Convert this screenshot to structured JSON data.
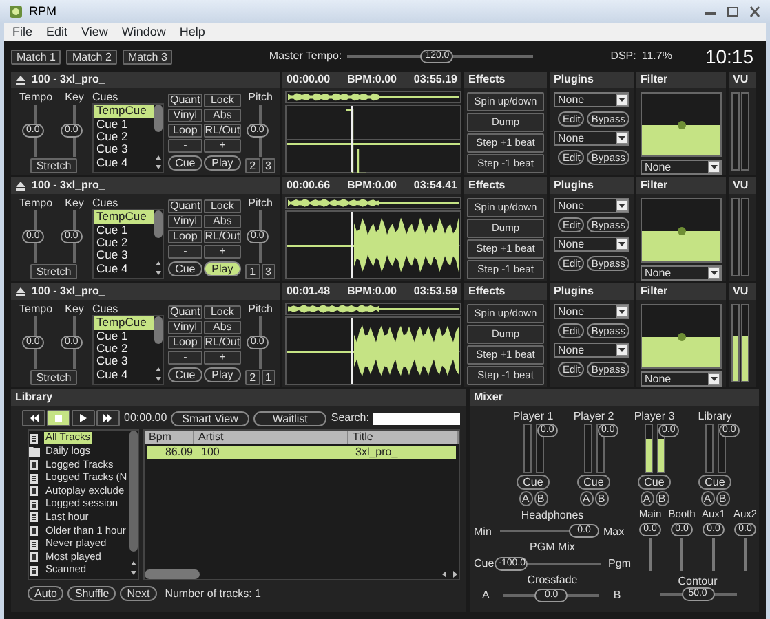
{
  "window": {
    "title": "RPM"
  },
  "menu": [
    "File",
    "Edit",
    "View",
    "Window",
    "Help"
  ],
  "toolbar": {
    "match_buttons": [
      "Match 1",
      "Match 2",
      "Match 3"
    ],
    "master_tempo": {
      "label": "Master Tempo:",
      "value": "120.0",
      "level": 0.48
    },
    "dsp": {
      "label": "DSP:",
      "value": "11.7%"
    },
    "clock": "10:15"
  },
  "decks": [
    {
      "title": "100 - 3xl_pro_",
      "tempo": {
        "label": "Tempo",
        "value": "0.0",
        "level": 0.5
      },
      "key": {
        "label": "Key",
        "value": "0.0",
        "level": 0.5
      },
      "stretch": "Stretch",
      "cues": {
        "label": "Cues",
        "items": [
          {
            "label": "TempCue",
            "selected": true
          },
          {
            "label": "Cue 1",
            "selected": false
          },
          {
            "label": "Cue 2",
            "selected": false
          },
          {
            "label": "Cue 3",
            "selected": false
          },
          {
            "label": "Cue 4",
            "selected": false
          }
        ]
      },
      "buttons": [
        "Quant",
        "Lock",
        "Vinyl",
        "Abs",
        "Loop",
        "RL/Out",
        "-",
        "+"
      ],
      "cue_button": "Cue",
      "play": {
        "label": "Play",
        "on": false
      },
      "pitch": {
        "label": "Pitch",
        "value": "0.0",
        "level": 0.5
      },
      "slots": [
        "2",
        "3"
      ],
      "waveform": {
        "time": "00:00.00",
        "bpm": "BPM:0.00",
        "duration": "03:55.19",
        "kind": "markers"
      },
      "effects": {
        "title": "Effects",
        "buttons": [
          "Spin up/down",
          "Dump",
          "Step +1 beat",
          "Step -1 beat"
        ]
      },
      "plugins": {
        "title": "Plugins",
        "slots": [
          {
            "value": "None",
            "edit": "Edit",
            "bypass": "Bypass"
          },
          {
            "value": "None",
            "edit": "Edit",
            "bypass": "Bypass"
          }
        ]
      },
      "filter": {
        "title": "Filter",
        "value": "None",
        "level": 0.5
      },
      "vu": {
        "title": "VU",
        "meters": [
          {
            "level": 0
          },
          {
            "level": 0
          }
        ]
      }
    },
    {
      "title": "100 - 3xl_pro_",
      "tempo": {
        "label": "Tempo",
        "value": "0.0",
        "level": 0.5
      },
      "key": {
        "label": "Key",
        "value": "0.0",
        "level": 0.5
      },
      "stretch": "Stretch",
      "cues": {
        "label": "Cues",
        "items": [
          {
            "label": "TempCue",
            "selected": true
          },
          {
            "label": "Cue 1",
            "selected": false
          },
          {
            "label": "Cue 2",
            "selected": false
          },
          {
            "label": "Cue 3",
            "selected": false
          },
          {
            "label": "Cue 4",
            "selected": false
          }
        ]
      },
      "buttons": [
        "Quant",
        "Lock",
        "Vinyl",
        "Abs",
        "Loop",
        "RL/Out",
        "-",
        "+"
      ],
      "cue_button": "Cue",
      "play": {
        "label": "Play",
        "on": true
      },
      "pitch": {
        "label": "Pitch",
        "value": "0.0",
        "level": 0.5
      },
      "slots": [
        "1",
        "3"
      ],
      "waveform": {
        "time": "00:00.66",
        "bpm": "BPM:0.00",
        "duration": "03:54.41",
        "kind": "wave"
      },
      "effects": {
        "title": "Effects",
        "buttons": [
          "Spin up/down",
          "Dump",
          "Step +1 beat",
          "Step -1 beat"
        ]
      },
      "plugins": {
        "title": "Plugins",
        "slots": [
          {
            "value": "None",
            "edit": "Edit",
            "bypass": "Bypass"
          },
          {
            "value": "None",
            "edit": "Edit",
            "bypass": "Bypass"
          }
        ]
      },
      "filter": {
        "title": "Filter",
        "value": "None",
        "level": 0.5
      },
      "vu": {
        "title": "VU",
        "meters": [
          {
            "level": 0
          },
          {
            "level": 0
          }
        ]
      }
    },
    {
      "title": "100 - 3xl_pro_",
      "tempo": {
        "label": "Tempo",
        "value": "0.0",
        "level": 0.5
      },
      "key": {
        "label": "Key",
        "value": "0.0",
        "level": 0.5
      },
      "stretch": "Stretch",
      "cues": {
        "label": "Cues",
        "items": [
          {
            "label": "TempCue",
            "selected": true
          },
          {
            "label": "Cue 1",
            "selected": false
          },
          {
            "label": "Cue 2",
            "selected": false
          },
          {
            "label": "Cue 3",
            "selected": false
          },
          {
            "label": "Cue 4",
            "selected": false
          }
        ]
      },
      "buttons": [
        "Quant",
        "Lock",
        "Vinyl",
        "Abs",
        "Loop",
        "RL/Out",
        "-",
        "+"
      ],
      "cue_button": "Cue",
      "play": {
        "label": "Play",
        "on": false
      },
      "pitch": {
        "label": "Pitch",
        "value": "0.0",
        "level": 0.5
      },
      "slots": [
        "2",
        "1"
      ],
      "waveform": {
        "time": "00:01.48",
        "bpm": "BPM:0.00",
        "duration": "03:53.59",
        "kind": "wave"
      },
      "effects": {
        "title": "Effects",
        "buttons": [
          "Spin up/down",
          "Dump",
          "Step +1 beat",
          "Step -1 beat"
        ]
      },
      "plugins": {
        "title": "Plugins",
        "slots": [
          {
            "value": "None",
            "edit": "Edit",
            "bypass": "Bypass"
          },
          {
            "value": "None",
            "edit": "Edit",
            "bypass": "Bypass"
          }
        ]
      },
      "filter": {
        "title": "Filter",
        "value": "None",
        "level": 0.5
      },
      "vu": {
        "title": "VU",
        "meters": [
          {
            "level": 0.6
          },
          {
            "level": 0.6
          }
        ]
      }
    }
  ],
  "library": {
    "title": "Library",
    "transport": [
      {
        "kind": "rewind",
        "selected": false
      },
      {
        "kind": "stop",
        "selected": true
      },
      {
        "kind": "play",
        "selected": false
      },
      {
        "kind": "forward",
        "selected": false
      }
    ],
    "time": "00:00.00",
    "smart_view": "Smart View",
    "waitlist": "Waitlist",
    "search": {
      "label": "Search:"
    },
    "tree": [
      {
        "label": "All Tracks",
        "kind": "list",
        "selected": true
      },
      {
        "label": "Daily logs",
        "kind": "folder",
        "selected": false
      },
      {
        "label": "Logged Tracks",
        "kind": "list",
        "selected": false
      },
      {
        "label": "Logged Tracks (N",
        "kind": "list",
        "selected": false
      },
      {
        "label": "Autoplay exclude",
        "kind": "list",
        "selected": false
      },
      {
        "label": "Logged session",
        "kind": "list",
        "selected": false
      },
      {
        "label": "Last hour",
        "kind": "list",
        "selected": false
      },
      {
        "label": "Older than 1 hour",
        "kind": "list",
        "selected": false
      },
      {
        "label": "Never played",
        "kind": "list",
        "selected": false
      },
      {
        "label": "Most played",
        "kind": "list",
        "selected": false
      },
      {
        "label": "Scanned",
        "kind": "list",
        "selected": false
      }
    ],
    "table": {
      "columns": [
        "Bpm",
        "Artist",
        "Title"
      ],
      "rows": [
        {
          "cells": [
            "86.09",
            "100",
            "3xl_pro_"
          ],
          "selected": true
        }
      ]
    },
    "buttons": [
      "Auto",
      "Shuffle",
      "Next"
    ],
    "track_count": "Number of tracks: 1"
  },
  "mixer": {
    "title": "Mixer",
    "channels": [
      {
        "label": "Player 1",
        "meters": [
          {
            "level": 0
          },
          {
            "level": 0
          }
        ],
        "gain": {
          "value": "0.0",
          "level": 1
        },
        "cue": "Cue",
        "outputs": [
          "A",
          "B"
        ]
      },
      {
        "label": "Player 2",
        "meters": [
          {
            "level": 0
          },
          {
            "level": 0
          }
        ],
        "gain": {
          "value": "0.0",
          "level": 1
        },
        "cue": "Cue",
        "outputs": [
          "A",
          "B"
        ]
      },
      {
        "label": "Player 3",
        "meters": [
          {
            "level": 0.7
          },
          {
            "level": 0.7
          }
        ],
        "gain": {
          "value": "0.0",
          "level": 1
        },
        "cue": "Cue",
        "outputs": [
          "A",
          "B"
        ]
      },
      {
        "label": "Library",
        "meters": [
          {
            "level": 0
          },
          {
            "level": 0
          }
        ],
        "gain": {
          "value": "0.0",
          "level": 1
        },
        "cue": "Cue",
        "outputs": [
          "A",
          "B"
        ]
      }
    ],
    "headphones": {
      "label": "Headphones",
      "min": "Min",
      "max": "Max",
      "value": "0.0",
      "level": 1
    },
    "pgm_mix": {
      "label": "PGM Mix",
      "left": "Cue",
      "right": "Pgm",
      "value": "-100.0",
      "level": 0
    },
    "crossfade": {
      "label": "Crossfade",
      "left": "A",
      "right": "B",
      "value": "0.0",
      "level": 0.5
    },
    "outputs": [
      {
        "label": "Main",
        "value": "0.0"
      },
      {
        "label": "Booth",
        "value": "0.0"
      },
      {
        "label": "Aux1",
        "value": "0.0"
      },
      {
        "label": "Aux2",
        "value": "0.0"
      }
    ],
    "contour": {
      "label": "Contour",
      "value": "50.0",
      "level": 0.5
    }
  }
}
